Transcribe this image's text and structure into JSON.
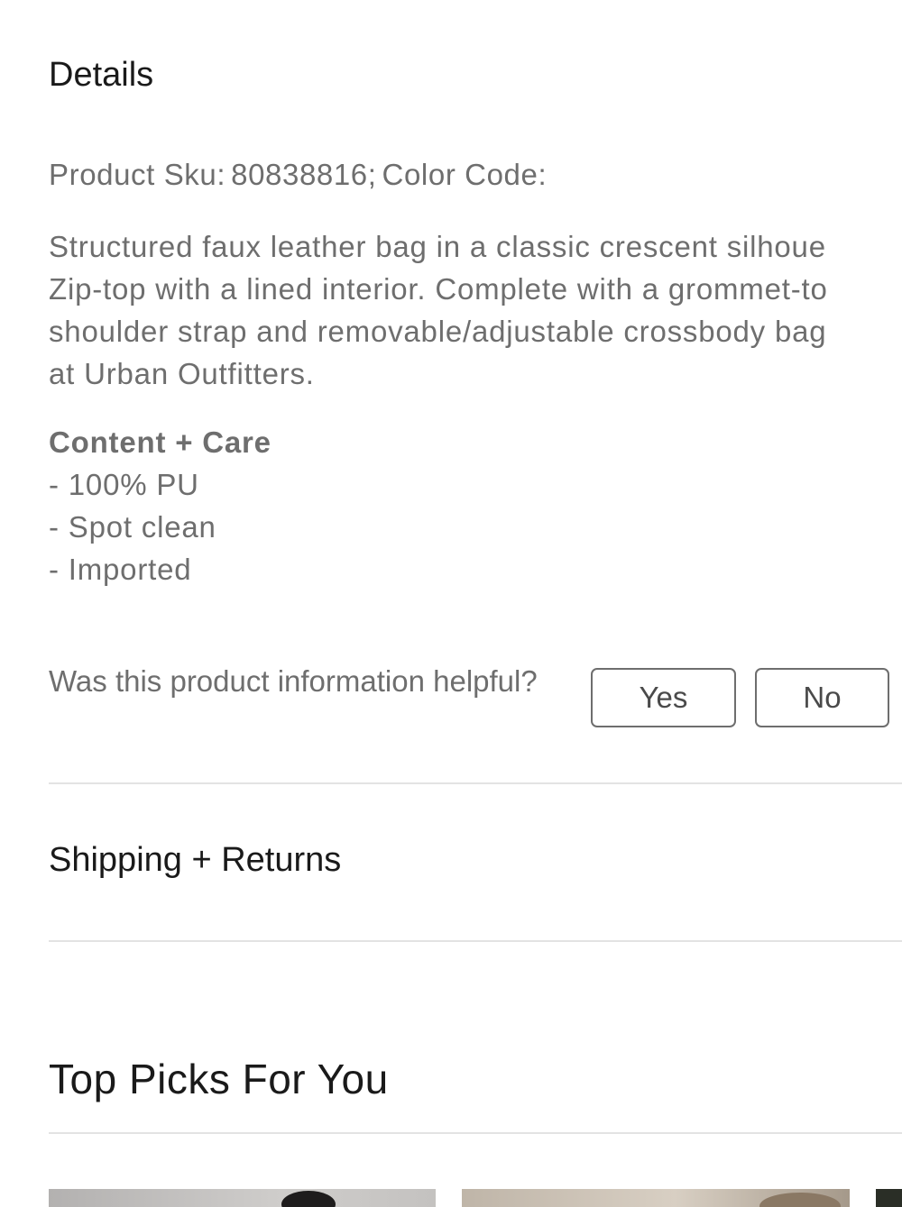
{
  "details": {
    "heading": "Details",
    "sku_label": "Product Sku:",
    "sku_value": "80838816;",
    "color_code_label": "Color Code:",
    "description_lines": [
      "Structured faux leather bag in a classic crescent silhoue",
      "Zip-top with a lined interior. Complete with a grommet-to",
      "shoulder strap and removable/adjustable crossbody bag",
      "at Urban Outfitters."
    ],
    "content_care": {
      "title": "Content + Care",
      "items": [
        "- 100% PU",
        "- Spot clean",
        "- Imported"
      ]
    }
  },
  "feedback": {
    "question": "Was this product information helpful?",
    "yes_label": "Yes",
    "no_label": "No"
  },
  "shipping": {
    "heading": "Shipping + Returns"
  },
  "top_picks": {
    "heading": "Top Picks For You"
  }
}
